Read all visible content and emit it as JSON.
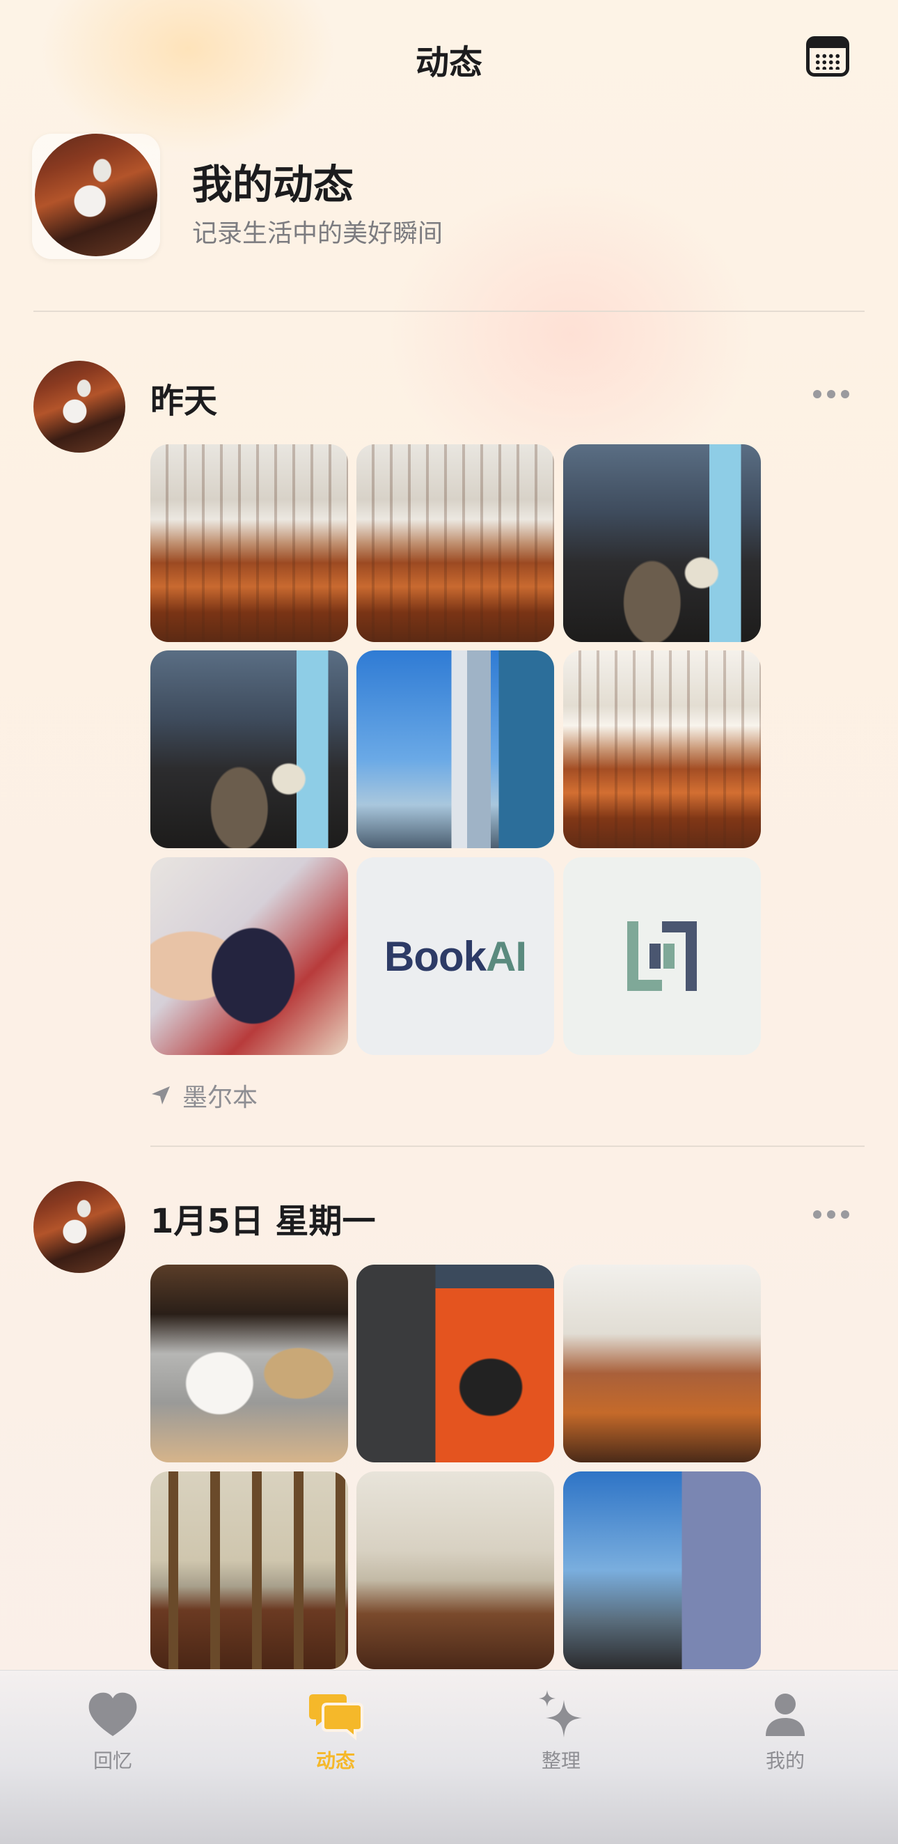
{
  "header": {
    "title": "动态",
    "calendar_icon": "calendar-icon"
  },
  "profile": {
    "name": "我的动态",
    "subtitle": "记录生活中的美好瞬间"
  },
  "posts": [
    {
      "date": "昨天",
      "photo_count": 9,
      "location": "墨尔本",
      "logo_text": {
        "part1": "Book",
        "part2": "AI"
      }
    },
    {
      "date": "1月5日 星期一",
      "photo_count": 6
    }
  ],
  "tabbar": {
    "items": [
      {
        "label": "回忆",
        "icon": "heart-icon",
        "active": false
      },
      {
        "label": "动态",
        "icon": "chat-bubbles-icon",
        "active": true
      },
      {
        "label": "整理",
        "icon": "sparkles-icon",
        "active": false
      },
      {
        "label": "我的",
        "icon": "person-icon",
        "active": false
      }
    ],
    "active_color": "#F5B82A",
    "inactive_color": "#8E8E93"
  }
}
